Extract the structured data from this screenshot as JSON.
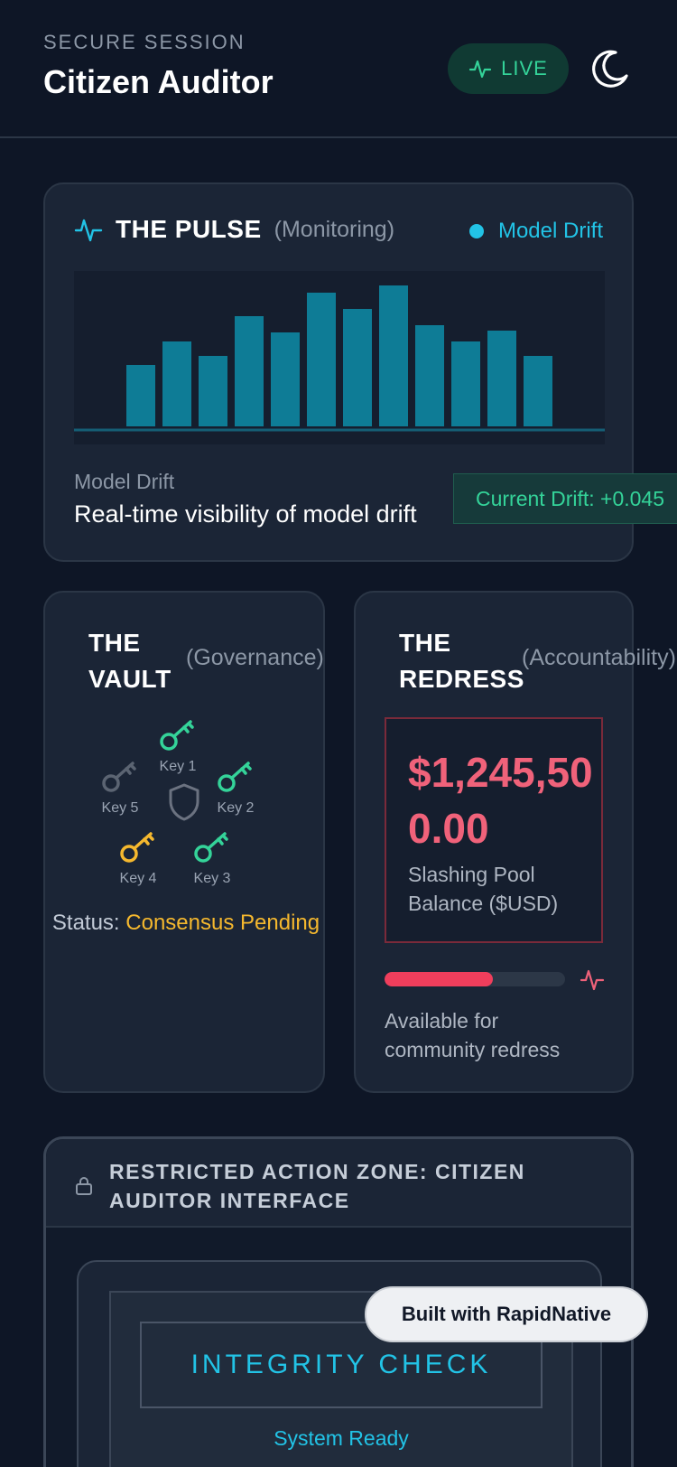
{
  "header": {
    "eyebrow": "SECURE SESSION",
    "title": "Citizen Auditor",
    "live_label": "LIVE",
    "icons": {
      "live": "pulse-icon",
      "theme": "moon-icon"
    },
    "colors": {
      "live": "#34d399",
      "bg": "#0e1626"
    }
  },
  "pulse": {
    "title": "THE PULSE",
    "subtitle": "(Monitoring)",
    "legend": "Model Drift",
    "label": "Model Drift",
    "description": "Real-time visibility of model drift",
    "badge": "Current Drift: +0.045"
  },
  "chart_data": {
    "type": "bar",
    "values": [
      34,
      47,
      39,
      61,
      52,
      74,
      65,
      78,
      56,
      47,
      53,
      39
    ],
    "ylim": [
      0,
      80
    ],
    "color": "#0e7c96",
    "series": [
      {
        "name": "Model Drift"
      }
    ]
  },
  "vault": {
    "title_line1": "THE",
    "title_line2": "VAULT",
    "subtitle": "(Governance)",
    "keys": [
      {
        "label": "Key 1",
        "color": "#34d399"
      },
      {
        "label": "Key 2",
        "color": "#34d399"
      },
      {
        "label": "Key 3",
        "color": "#34d399"
      },
      {
        "label": "Key 4",
        "color": "#f5b82e"
      },
      {
        "label": "Key 5",
        "color": "#6b7280"
      }
    ],
    "status_prefix": "Status:",
    "status_value": "Consensus Pending"
  },
  "redress": {
    "title_line1": "THE",
    "title_line2": "REDRESS",
    "subtitle": "(Accountability)",
    "amount": "$1,245,500.00",
    "amount_label": "Slashing Pool Balance ($USD)",
    "progress": 0.6,
    "availability": "Available for community redress"
  },
  "zone": {
    "title": "RESTRICTED ACTION ZONE: CITIZEN AUDITOR INTERFACE",
    "check_label": "INTEGRITY CHECK",
    "status": "System Ready"
  },
  "footer_badge": "Built with RapidNative"
}
